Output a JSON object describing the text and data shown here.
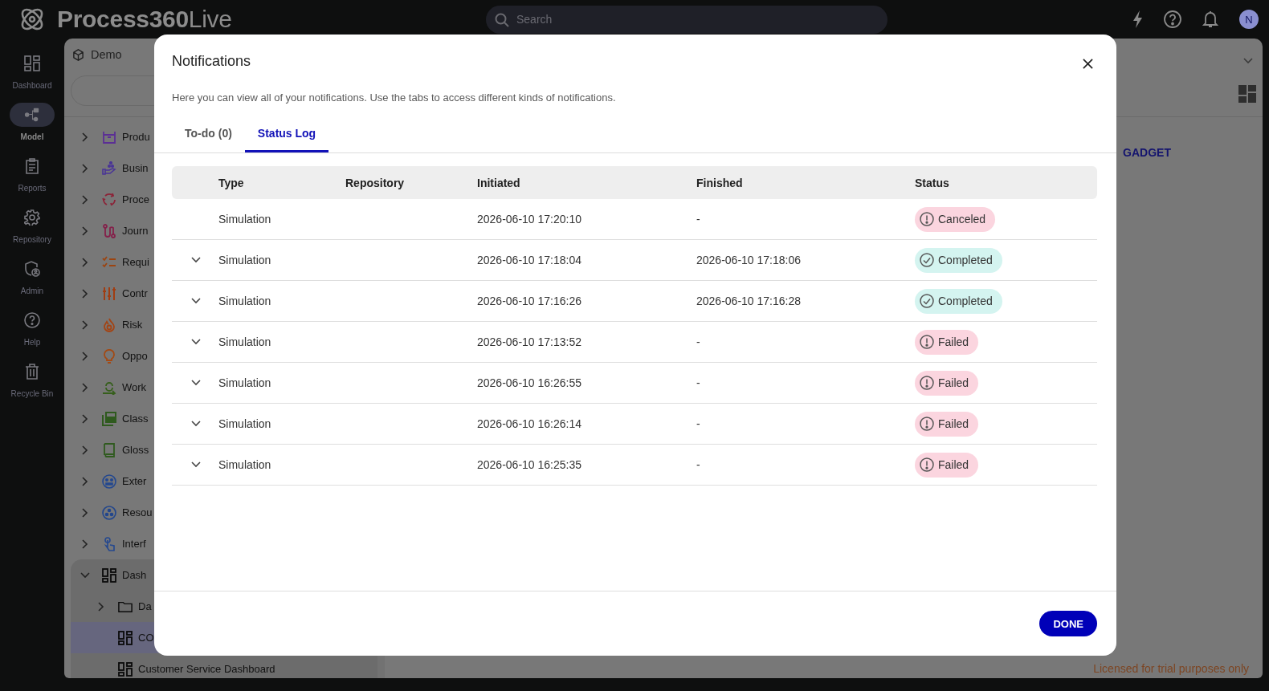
{
  "topbar": {
    "logo": {
      "bold": "Process360",
      "light": "Live"
    },
    "search": {
      "placeholder": "Search"
    },
    "avatar": "N"
  },
  "rail": [
    {
      "label": "Dashboard",
      "selected": false
    },
    {
      "label": "Model",
      "selected": true
    },
    {
      "label": "Reports",
      "selected": false
    },
    {
      "label": "Repository",
      "selected": false
    },
    {
      "label": "Admin",
      "selected": false
    },
    {
      "label": "Help",
      "selected": false
    },
    {
      "label": "Recycle Bin",
      "selected": false
    }
  ],
  "panel": {
    "title": "Demo",
    "tree": [
      {
        "label": "Produ",
        "kind": "branch",
        "expanded": false,
        "selected": false,
        "color": "#5b2e95"
      },
      {
        "label": "Busin",
        "kind": "branch",
        "expanded": false,
        "selected": false,
        "color": "#4a3596"
      },
      {
        "label": "Proce",
        "kind": "branch",
        "expanded": false,
        "selected": false,
        "color": "#8c2338"
      },
      {
        "label": "Journ",
        "kind": "branch",
        "expanded": false,
        "selected": false,
        "color": "#84204a"
      },
      {
        "label": "Requi",
        "kind": "branch",
        "expanded": false,
        "selected": false,
        "color": "#9c4410"
      },
      {
        "label": "Contr",
        "kind": "branch",
        "expanded": false,
        "selected": false,
        "color": "#a03d12"
      },
      {
        "label": "Risk",
        "kind": "branch",
        "expanded": false,
        "selected": false,
        "color": "#a34414"
      },
      {
        "label": "Oppo",
        "kind": "branch",
        "expanded": false,
        "selected": false,
        "color": "#a34a14"
      },
      {
        "label": "Work",
        "kind": "branch",
        "expanded": false,
        "selected": false,
        "color": "#365f1c"
      },
      {
        "label": "Class",
        "kind": "branch",
        "expanded": false,
        "selected": false,
        "color": "#2f5a1e"
      },
      {
        "label": "Gloss",
        "kind": "branch",
        "expanded": false,
        "selected": false,
        "color": "#2f5a1e"
      },
      {
        "label": "Exter",
        "kind": "branch",
        "expanded": false,
        "selected": false,
        "color": "#24488f"
      },
      {
        "label": "Resou",
        "kind": "branch",
        "expanded": false,
        "selected": false,
        "color": "#22468c"
      },
      {
        "label": "Interf",
        "kind": "branch",
        "expanded": false,
        "selected": false,
        "color": "#24488f"
      },
      {
        "label": "Dash",
        "kind": "branch",
        "expanded": true,
        "selected": false,
        "color": "#0a0a0a",
        "children": [
          {
            "label": "Da",
            "kind": "branch",
            "expanded": false,
            "selected": false,
            "color": "#0a0a0a"
          },
          {
            "label": "CO",
            "kind": "leaf",
            "selected": true,
            "color": "#0a0a0a"
          },
          {
            "label": "Customer Service Dashboard",
            "kind": "leaf",
            "selected": false,
            "color": "#0a0a0a"
          }
        ]
      }
    ],
    "gadget_link": "GADGET",
    "license_note": "Licensed for trial purposes only"
  },
  "dialog": {
    "title": "Notifications",
    "description": "Here you can view all of your notifications. Use the tabs to access different kinds of notifications.",
    "tabs": [
      {
        "label": "To-do (0)",
        "selected": false
      },
      {
        "label": "Status Log",
        "selected": true
      }
    ],
    "columns": [
      "Type",
      "Repository",
      "Initiated",
      "Finished",
      "Status"
    ],
    "rows": [
      {
        "expandable": false,
        "type": "Simulation",
        "initiated": "2026-06-10 17:20:10",
        "finished": "-",
        "status": {
          "kind": "canceled",
          "label": "Canceled"
        }
      },
      {
        "expandable": true,
        "type": "Simulation",
        "initiated": "2026-06-10 17:18:04",
        "finished": "2026-06-10 17:18:06",
        "status": {
          "kind": "completed",
          "label": "Completed"
        }
      },
      {
        "expandable": true,
        "type": "Simulation",
        "initiated": "2026-06-10 17:16:26",
        "finished": "2026-06-10 17:16:28",
        "status": {
          "kind": "completed",
          "label": "Completed"
        }
      },
      {
        "expandable": true,
        "type": "Simulation",
        "initiated": "2026-06-10 17:13:52",
        "finished": "-",
        "status": {
          "kind": "failed",
          "label": "Failed"
        }
      },
      {
        "expandable": true,
        "type": "Simulation",
        "initiated": "2026-06-10 16:26:55",
        "finished": "-",
        "status": {
          "kind": "failed",
          "label": "Failed"
        }
      },
      {
        "expandable": true,
        "type": "Simulation",
        "initiated": "2026-06-10 16:26:14",
        "finished": "-",
        "status": {
          "kind": "failed",
          "label": "Failed"
        }
      },
      {
        "expandable": true,
        "type": "Simulation",
        "initiated": "2026-06-10 16:25:35",
        "finished": "-",
        "status": {
          "kind": "failed",
          "label": "Failed"
        }
      }
    ],
    "done_button": "DONE"
  }
}
